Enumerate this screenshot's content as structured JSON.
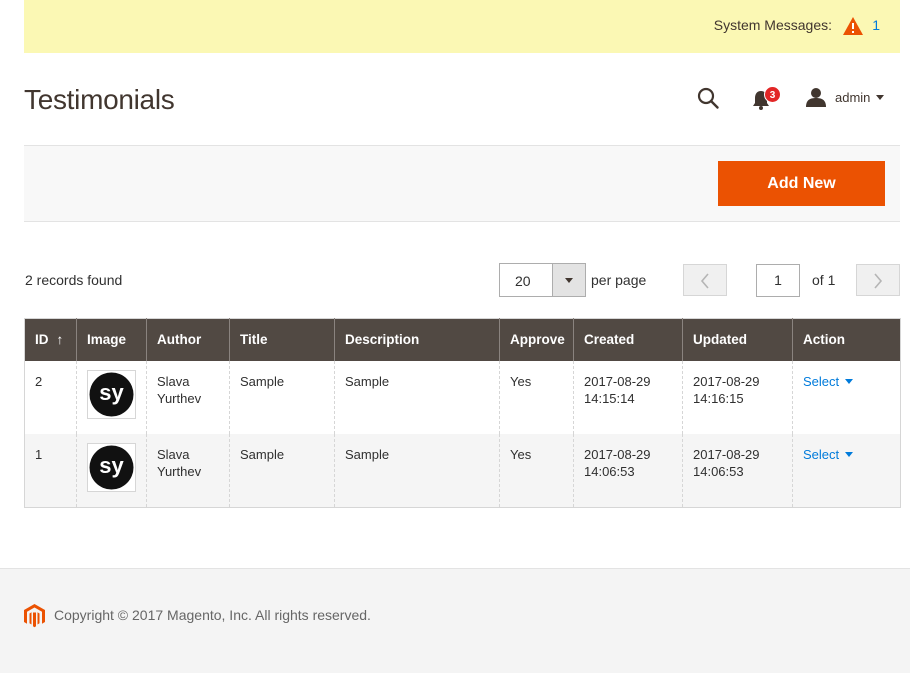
{
  "system_messages": {
    "label": "System Messages:",
    "count": "1",
    "icon": "warning-icon",
    "warn_color": "#eb5202"
  },
  "page": {
    "title": "Testimonials"
  },
  "header": {
    "notifications_count": "3",
    "user_name": "admin"
  },
  "actions": {
    "add_new_label": "Add New",
    "add_new_color": "#eb5202"
  },
  "toolbar": {
    "records_found": "2 records found",
    "per_page_value": "20",
    "per_page_label": "per page",
    "current_page": "1",
    "of_pages": "of 1"
  },
  "grid": {
    "columns": [
      "ID",
      "Image",
      "Author",
      "Title",
      "Description",
      "Approve",
      "Created",
      "Updated",
      "Action"
    ],
    "sort_indicator": "↑",
    "rows": [
      {
        "id": "2",
        "image_logo_text": "sy",
        "author_line1": "Slava",
        "author_line2": "Yurthev",
        "title": "Sample",
        "description": "Sample",
        "approve": "Yes",
        "created_date": "2017-08-29",
        "created_time": "14:15:14",
        "updated_date": "2017-08-29",
        "updated_time": "14:16:15",
        "action": "Select"
      },
      {
        "id": "1",
        "image_logo_text": "sy",
        "author_line1": "Slava",
        "author_line2": "Yurthev",
        "title": "Sample",
        "description": "Sample",
        "approve": "Yes",
        "created_date": "2017-08-29",
        "created_time": "14:06:53",
        "updated_date": "2017-08-29",
        "updated_time": "14:06:53",
        "action": "Select"
      }
    ]
  },
  "footer": {
    "copyright": "Copyright © 2017 Magento, Inc. All rights reserved."
  }
}
